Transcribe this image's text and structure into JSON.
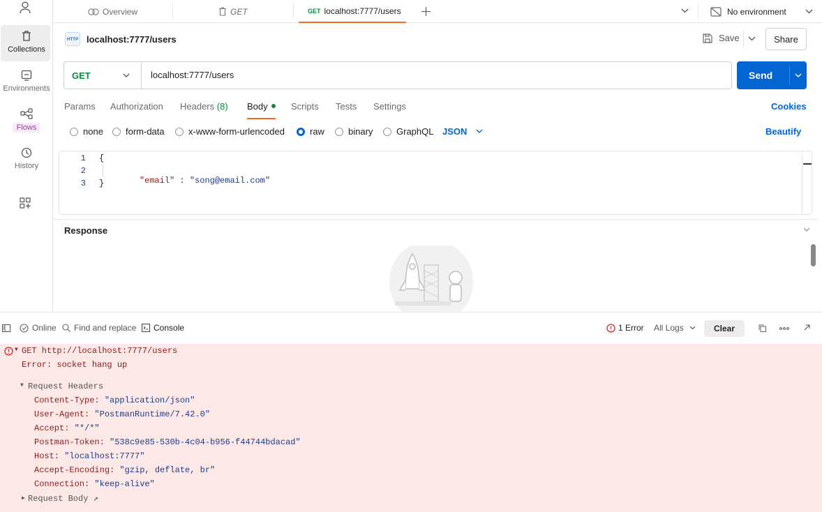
{
  "rail": {
    "items": [
      {
        "label": "Collections",
        "icon": "trash-can-icon"
      },
      {
        "label": "Environments",
        "icon": "environments-icon"
      },
      {
        "label": "Flows",
        "icon": "flows-icon"
      },
      {
        "label": "History",
        "icon": "history-icon"
      }
    ]
  },
  "tabs": {
    "overview": "Overview",
    "get_tab": "GET",
    "active_method": "GET",
    "active_label": "localhost:7777/users",
    "environment": "No environment"
  },
  "request": {
    "title": "localhost:7777/users",
    "http_badge": "HTTP",
    "save_label": "Save",
    "share_label": "Share",
    "method": "GET",
    "url": "localhost:7777/users",
    "send_label": "Send"
  },
  "subtabs": {
    "params": "Params",
    "authorization": "Authorization",
    "headers": "Headers",
    "headers_count": "(8)",
    "body": "Body",
    "scripts": "Scripts",
    "tests": "Tests",
    "settings": "Settings",
    "cookies": "Cookies"
  },
  "body_types": {
    "none": "none",
    "form_data": "form-data",
    "urlencoded": "x-www-form-urlencoded",
    "raw": "raw",
    "binary": "binary",
    "graphql": "GraphQL",
    "format": "JSON",
    "beautify": "Beautify"
  },
  "editor": {
    "line_numbers": [
      "1",
      "2",
      "3"
    ],
    "open_brace": "{",
    "key": "\"email\"",
    "colon": " : ",
    "value": "\"song@email.com\"",
    "close_brace": "}"
  },
  "response": {
    "title": "Response"
  },
  "console_bar": {
    "online": "Online",
    "find_replace": "Find and replace",
    "console": "Console",
    "errors": "1 Error",
    "logs_filter": "All Logs",
    "clear": "Clear"
  },
  "console": {
    "request_line": "GET http://localhost:7777/users",
    "error": "Error: socket hang up",
    "request_headers_label": "Request Headers",
    "headers": [
      {
        "key": "Content-Type:",
        "value": "\"application/json\""
      },
      {
        "key": "User-Agent:",
        "value": "\"PostmanRuntime/7.42.0\""
      },
      {
        "key": "Accept:",
        "value": "\"*/*\""
      },
      {
        "key": "Postman-Token:",
        "value": "\"538c9e85-530b-4c04-b956-f44744bdacad\""
      },
      {
        "key": "Host:",
        "value": "\"localhost:7777\""
      },
      {
        "key": "Accept-Encoding:",
        "value": "\"gzip, deflate, br\""
      },
      {
        "key": "Connection:",
        "value": "\"keep-alive\""
      }
    ],
    "request_body_label": "Request Body ↗"
  },
  "colors": {
    "accent": "#0265d2",
    "brand_orange": "#f26b22",
    "console_error_bg": "#fce9e7",
    "method_green": "#0b8a3f"
  }
}
